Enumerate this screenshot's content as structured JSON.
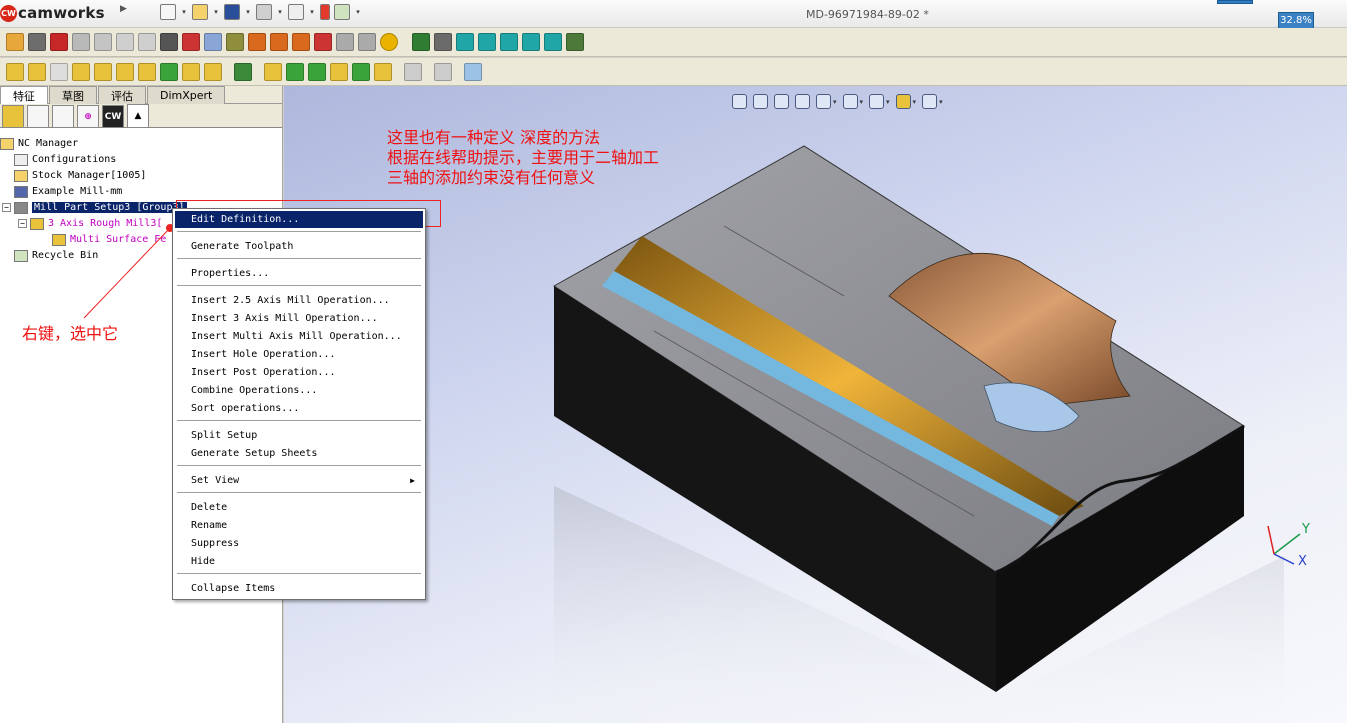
{
  "app": {
    "brand_badge": "CW",
    "brand": "camworks",
    "document_title": "MD-96971984-89-02 *",
    "zoom_readout": "32.8%"
  },
  "feature_tabs": [
    "特征",
    "草图",
    "评估",
    "DimXpert"
  ],
  "manager_tab_cw": "CW",
  "tree": {
    "nc_manager": "NC Manager",
    "configurations": "Configurations",
    "stock_manager": "Stock Manager[1005]",
    "example_mill": "Example Mill-mm",
    "mill_part_setup": "Mill Part Setup3 [Group3]",
    "rough_mill": "3 Axis Rough Mill3[",
    "multi_surface": "Multi Surface Fe",
    "recycle_bin": "Recycle Bin"
  },
  "context_menu": {
    "edit_definition": "Edit Definition...",
    "generate_toolpath": "Generate Toolpath",
    "properties": "Properties...",
    "insert_25_axis": "Insert 2.5 Axis Mill Operation...",
    "insert_3_axis": "Insert 3 Axis Mill Operation...",
    "insert_multi_axis": "Insert Multi Axis Mill Operation...",
    "insert_hole": "Insert Hole Operation...",
    "insert_post": "Insert Post Operation...",
    "combine": "Combine Operations...",
    "sort": "Sort operations...",
    "split_setup": "Split Setup",
    "setup_sheets": "Generate Setup Sheets",
    "set_view": "Set View",
    "delete": "Delete",
    "rename": "Rename",
    "suppress": "Suppress",
    "hide": "Hide",
    "collapse": "Collapse Items"
  },
  "annotations": {
    "line1": "这里也有一种定义 深度的方法",
    "line2": "根据在线帮助提示，主要用于二轴加工",
    "line3": "三轴的添加约束没有任何意义",
    "right_click": "右键，选中它"
  },
  "triad": {
    "x": "X",
    "y": "Y"
  }
}
